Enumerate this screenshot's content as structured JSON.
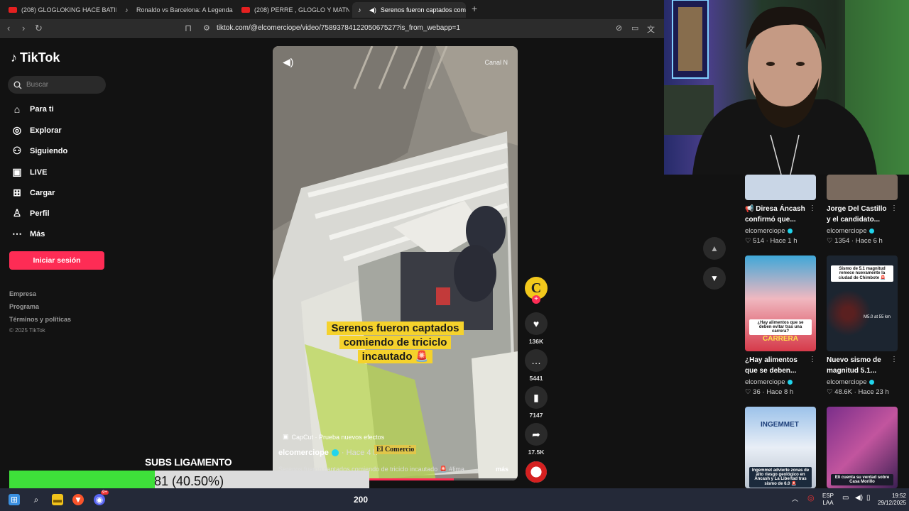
{
  "browser": {
    "tabs": [
      {
        "title": "(208) GLOGLOKING HACE BATIDOS L",
        "kind": "youtube"
      },
      {
        "title": "Ronaldo vs Barcelona: A Legendary S",
        "kind": "tiktok"
      },
      {
        "title": "(208) PERRE , GLOGLO Y MATNAROK",
        "kind": "youtube"
      },
      {
        "title": "Serenos fueron captados com",
        "kind": "tiktok",
        "active": true
      }
    ],
    "close_symbol": "✕",
    "new_tab_symbol": "+",
    "url": "tiktok.com/@elcomerciope/video/7589378412205067527?is_from_webapp=1"
  },
  "sidebar": {
    "brand": "TikTok",
    "search_placeholder": "Buscar",
    "nav": [
      {
        "label": "Para ti",
        "icon": "home-icon"
      },
      {
        "label": "Explorar",
        "icon": "compass-icon"
      },
      {
        "label": "Siguiendo",
        "icon": "following-icon"
      },
      {
        "label": "LIVE",
        "icon": "live-icon"
      },
      {
        "label": "Cargar",
        "icon": "upload-icon"
      },
      {
        "label": "Perfil",
        "icon": "profile-icon"
      },
      {
        "label": "Más",
        "icon": "more-icon"
      }
    ],
    "login_label": "Iniciar sesión",
    "footer_links": [
      "Empresa",
      "Programa",
      "Términos y políticas"
    ],
    "copyright": "© 2025 TikTok"
  },
  "video": {
    "watermark": "Canal N",
    "overlay_caption": "Serenos fueron captados comiendo de triciclo incautado 🚨",
    "capcut_label": "CapCut · Prueba nuevos efectos",
    "author": "elcomerciope",
    "time_ago": "· Hace 4 h",
    "logo_text": "El Comercio",
    "description": "Serenos fueron captados comiendo de triciclo incautado 🚨 #lima ...",
    "more_label": "más",
    "progress": 0.74
  },
  "actions": {
    "avatar_letter": "C",
    "likes": "136K",
    "comments": "5441",
    "saves": "7147",
    "shares": "17.5K"
  },
  "related": [
    {
      "title": "📢 Diresa Áncash confirmó que...",
      "author": "elcomerciope",
      "likes": "514",
      "ago": "Hace 1 h",
      "thumb_color": "#c9d6e6"
    },
    {
      "title": "Jorge Del Castillo y el candidato...",
      "author": "elcomerciope",
      "likes": "1354",
      "ago": "Hace 6 h",
      "thumb_color": "#7a6a5e"
    },
    {
      "title": "¿Hay alimentos que se deben...",
      "author": "elcomerciope",
      "likes": "36",
      "ago": "Hace 8 h",
      "thumb_color": "#d63a4a",
      "thumb_caption": "¿Hay alimentos que se deben evitar tras una carrera?",
      "thumb_tag": "CARRERA"
    },
    {
      "title": "Nuevo sismo de magnitud 5.1...",
      "author": "elcomerciope",
      "likes": "48.6K",
      "ago": "Hace 23 h",
      "thumb_color": "#1c2530",
      "thumb_caption": "Sismo de 5.1 magnitud remece nuevamente la ciudad de Chimbote 🚨",
      "thumb_tag": "M5.0 at 55 km"
    },
    {
      "thumb_color": "#7fa6d6",
      "thumb_caption": "Ingemmet advierte zonas de alto riesgo geológico en Áncash y La Libertad tras sismo de 6.0 🚨",
      "thumb_tag": "INGEMMET"
    },
    {
      "thumb_color": "#a23a8e",
      "thumb_caption": "Eli cuenta su verdad sobre Casa Morillo"
    }
  ],
  "stream": {
    "subs_label": "SUBS LIGAMENTO",
    "subs_text": "81 (40.50%)",
    "subs_progress": 0.405
  },
  "taskbar": {
    "counter": "200",
    "lang_top": "ESP",
    "lang_bottom": "LAA",
    "time": "19:52",
    "date": "29/12/2025",
    "discord_badge": "9+"
  }
}
